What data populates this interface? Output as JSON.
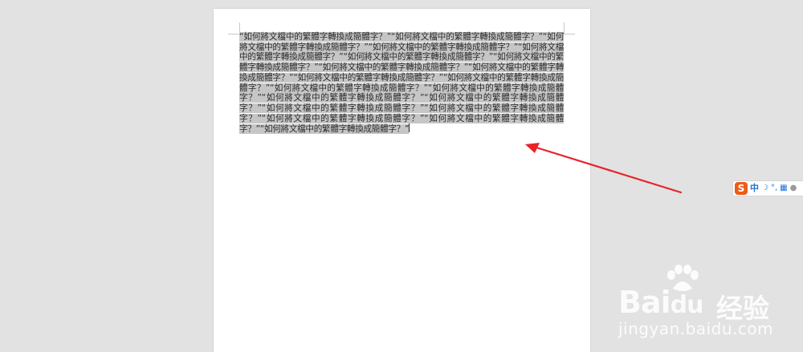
{
  "document": {
    "text": "“如何將文檔中的繁體字轉換成簡體字？”“如何將文檔中的繁體字轉換成簡體字？”“如何將文檔中的繁體字轉換成簡體字？”“如何將文檔中的繁體字轉換成簡體字？”“如何將文檔中的繁體字轉換成簡體字？”“如何將文檔中的繁體字轉換成簡體字？”“如何將文檔中的繁體字轉換成簡體字？”“如何將文檔中的繁體字轉換成簡體字？”“如何將文檔中的繁體字轉換成簡體字？”“如何將文檔中的繁體字轉換成簡體字？”“如何將文檔中的繁體字轉換成簡體字？”“如何將文檔中的繁體字轉換成簡體字？”“如何將文檔中的繁體字轉換成簡體字？”“如何將文檔中的繁體字轉換成簡體字？”“如何將文檔中的繁體字轉換成簡體字？”“如何將文檔中的繁體字轉換成簡體字？”“如何將文檔中的繁體字轉換成簡體字？”“如何將文檔中的繁體字轉換成簡體字？”“如何將文檔中的繁體字轉換成簡體字？”“如何將文檔中的繁體字轉換成簡體字？”",
    "selected": true,
    "selection_color": "#c6c6c6"
  },
  "annotation": {
    "arrow_color": "#e8232a"
  },
  "ime_toolbar": {
    "logo": "S",
    "mode": "中",
    "punct_icon": "☽",
    "comma_icon": "°,",
    "keyboard_icon": "▦",
    "user_icon": "●"
  },
  "watermark": {
    "brand": "Bai",
    "brand_tail": "du",
    "label_cn": "经验",
    "url": "jingyan.baidu.com"
  },
  "colors": {
    "background": "#e2e2e2",
    "page": "#ffffff",
    "ime_accent": "#1a73d9",
    "ime_logo": "#ee5b17"
  }
}
